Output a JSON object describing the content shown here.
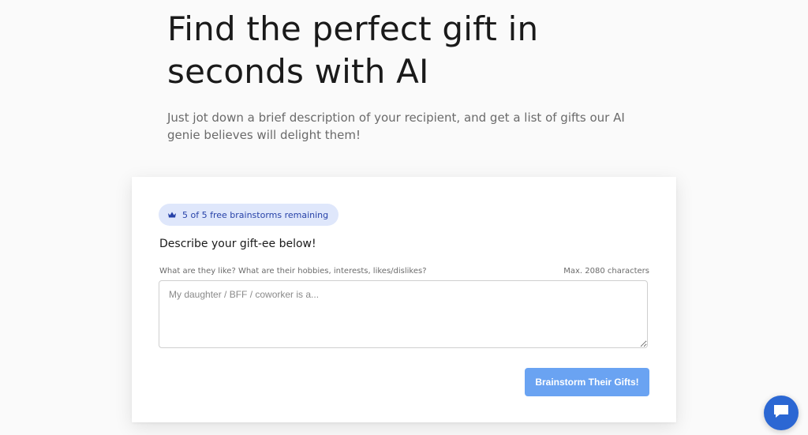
{
  "hero": {
    "title_line1": "Find the perfect gift in",
    "title_line2": "seconds with AI",
    "subtitle": "Just jot down a brief description of your recipient, and get a list of gifts our AI genie believes will delight them!"
  },
  "card": {
    "badge_text": "5 of 5 free brainstorms remaining",
    "heading": "Describe your gift-ee below!",
    "field_label": "What are they like? What are their hobbies, interests, likes/dislikes?",
    "max_chars": "Max. 2080 characters",
    "placeholder": "My daughter / BFF / coworker is a...",
    "submit_label": "Brainstorm Their Gifts!"
  },
  "icons": {
    "badge_icon": "crown-icon",
    "chat_icon": "chat-bubble-icon"
  },
  "colors": {
    "badge_bg": "#dfe7fb",
    "badge_text": "#2742a8",
    "button": "#6aa3f2",
    "chat_fab": "#2b67d3"
  }
}
